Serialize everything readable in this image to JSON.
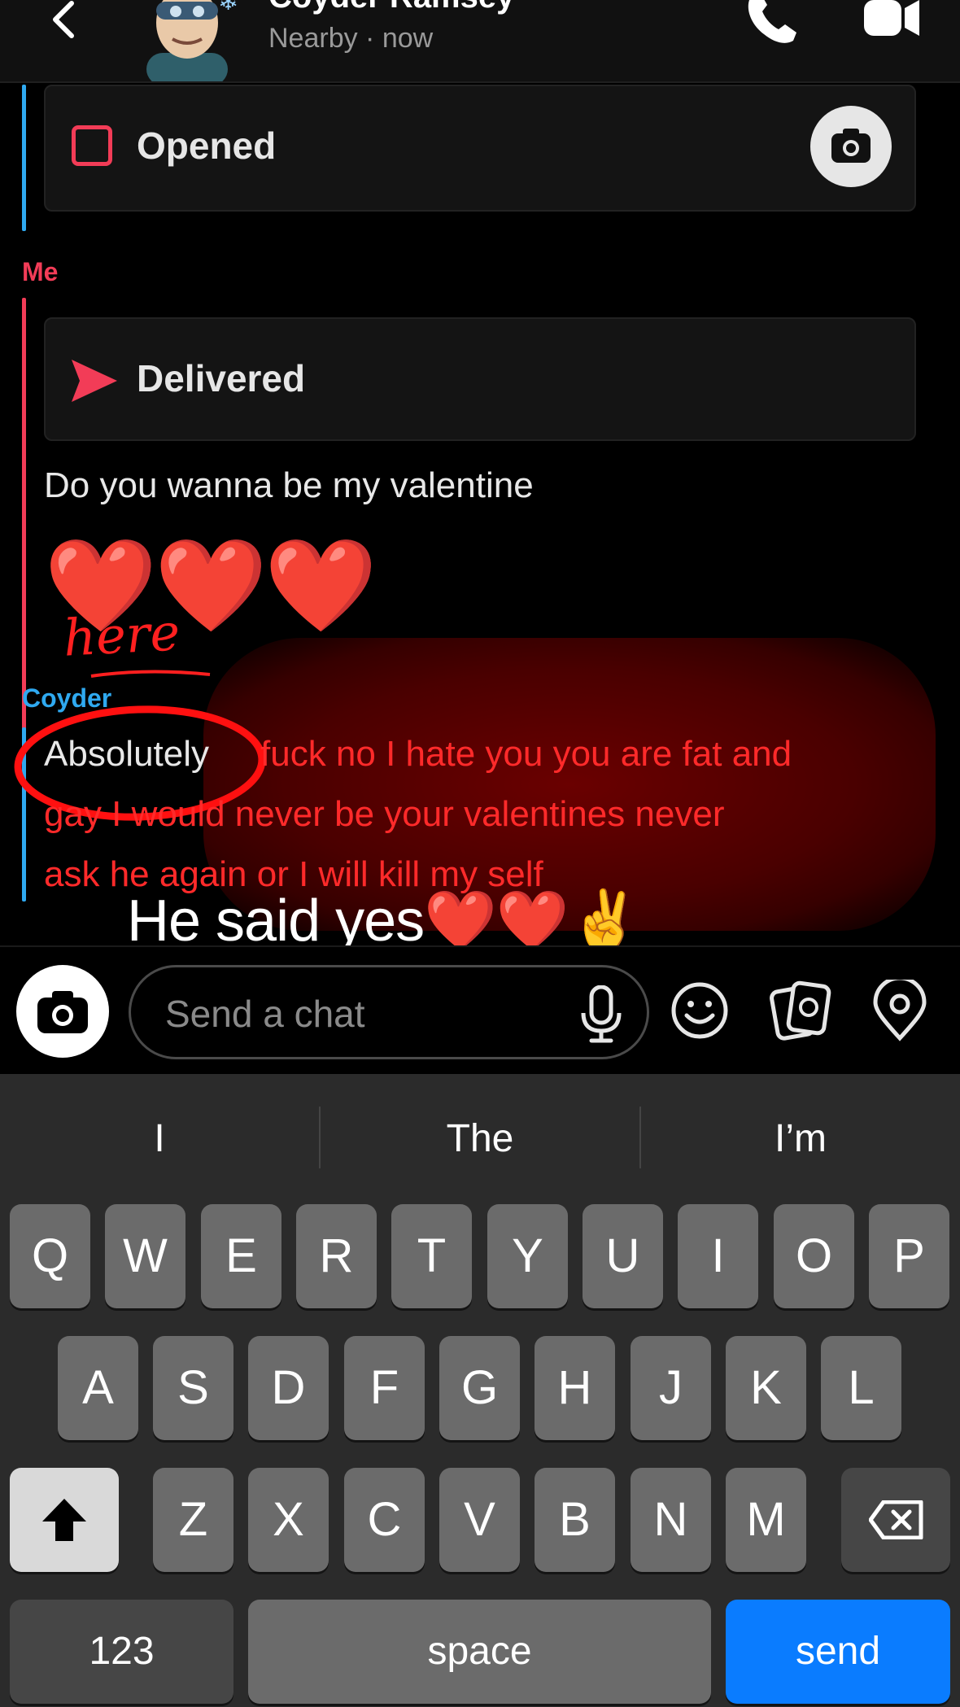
{
  "header": {
    "contact_name": "Coyder Ramsey",
    "status": "Nearby · now",
    "icons": [
      "back-chevron-icon",
      "bitmoji-avatar",
      "phone-icon",
      "video-camera-icon"
    ]
  },
  "chat": {
    "snap_opened_label": "Opened",
    "me_label": "Me",
    "snap_delivered_label": "Delivered",
    "me_message": "Do you wanna be my valentine",
    "hearts": "❤️❤️❤️",
    "annotation_here": "here",
    "friend_label": "Coyder",
    "friend_message_word": "Absolutely",
    "scribbled_line1": "fuck no I hate you you are fat and",
    "scribbled_line2": "gay I would never be your valentines never",
    "scribbled_line3": "ask he again or I will kill my self",
    "overlay_caption": "He said yes❤️❤️✌️",
    "colors": {
      "me": "#f23c57",
      "friend": "#2fa9f0",
      "annotation": "#ff1f1f"
    }
  },
  "composer": {
    "placeholder": "Send a chat",
    "icons": [
      "camera-icon",
      "microphone-icon",
      "smiley-icon",
      "stickers-icon",
      "location-pin-icon"
    ]
  },
  "keyboard": {
    "suggestions": [
      "I",
      "The",
      "I’m"
    ],
    "row1": [
      "Q",
      "W",
      "E",
      "R",
      "T",
      "Y",
      "U",
      "I",
      "O",
      "P"
    ],
    "row2": [
      "A",
      "S",
      "D",
      "F",
      "G",
      "H",
      "J",
      "K",
      "L"
    ],
    "row3": [
      "Z",
      "X",
      "C",
      "V",
      "B",
      "N",
      "M"
    ],
    "numbers_label": "123",
    "space_label": "space",
    "send_label": "send",
    "send_color": "#0a7cff"
  }
}
